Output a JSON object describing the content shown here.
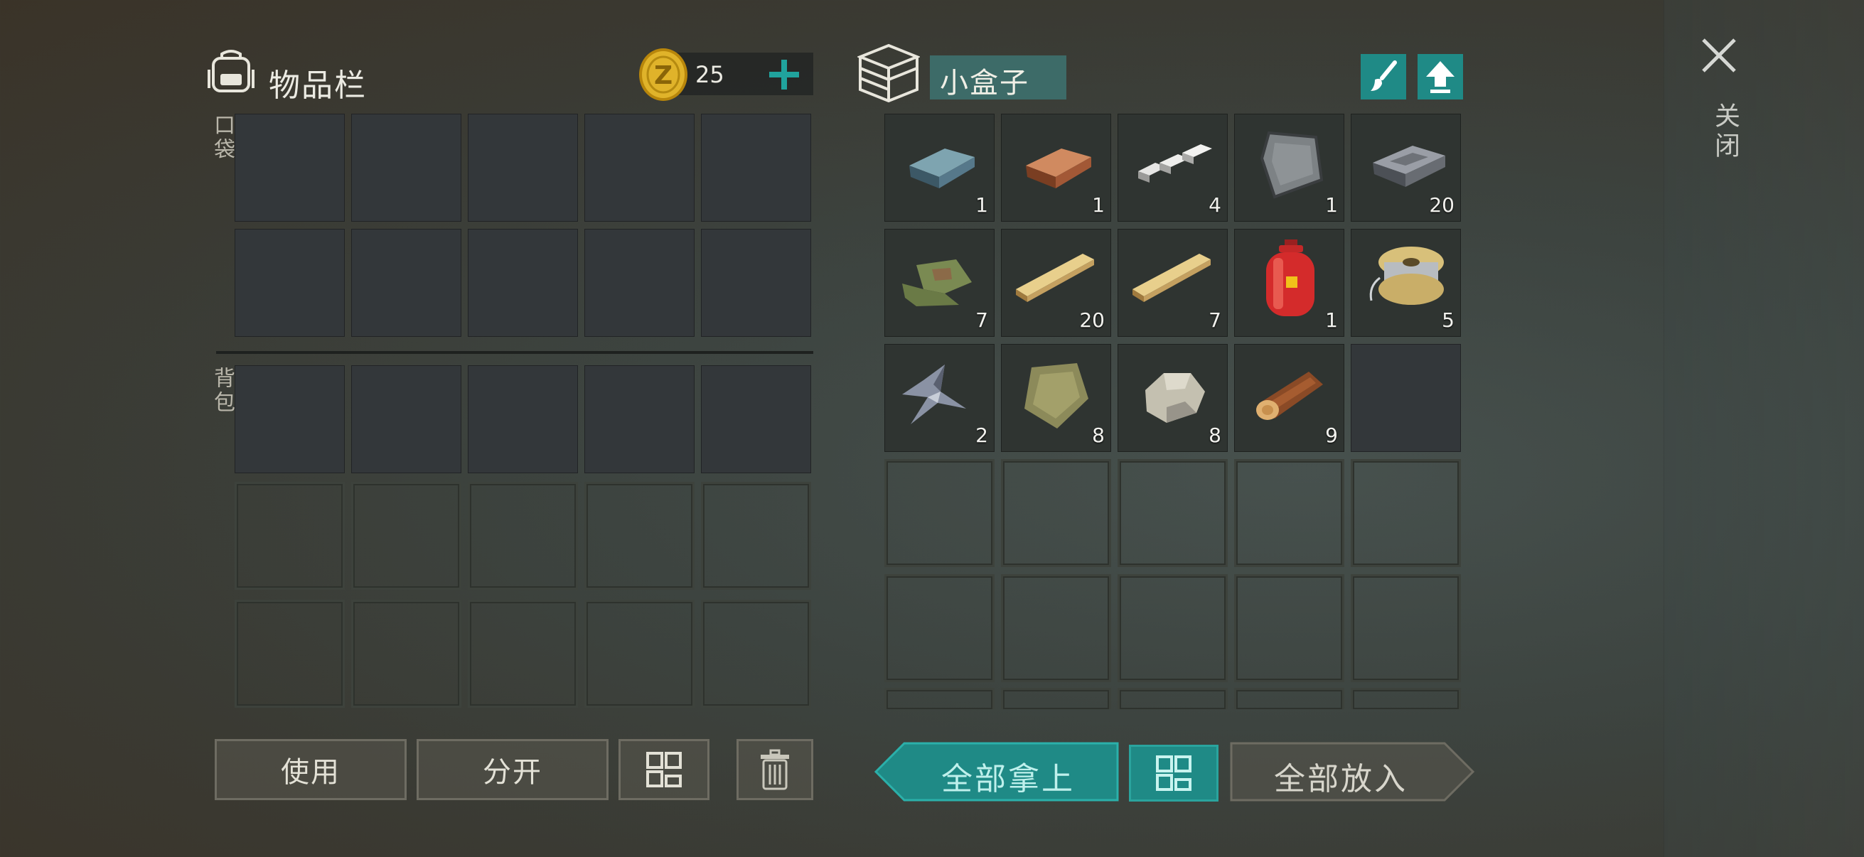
{
  "inventory": {
    "title": "物品栏",
    "coins": "25",
    "pocket_label": "口袋",
    "backpack_label": "背包"
  },
  "container": {
    "name": "小盒子",
    "items": [
      {
        "name": "steel-ingot",
        "count": "1"
      },
      {
        "name": "copper-ingot",
        "count": "1"
      },
      {
        "name": "aluminum-bars",
        "count": "4"
      },
      {
        "name": "metal-plate",
        "count": "1"
      },
      {
        "name": "iron-ingot",
        "count": "20"
      },
      {
        "name": "tarp-cloth",
        "count": "7"
      },
      {
        "name": "wood-plank",
        "count": "20"
      },
      {
        "name": "wood-plank",
        "count": "7"
      },
      {
        "name": "gas-cylinder",
        "count": "1"
      },
      {
        "name": "wire-spool",
        "count": "5"
      },
      {
        "name": "metal-scrap",
        "count": "2"
      },
      {
        "name": "burlap-cloth",
        "count": "8"
      },
      {
        "name": "stone",
        "count": "8"
      },
      {
        "name": "log",
        "count": "9"
      }
    ]
  },
  "buttons": {
    "use": "使用",
    "split": "分开",
    "take_all": "全部拿上",
    "put_all": "全部放入"
  },
  "close_label": "关闭",
  "colors": {
    "accent_teal": "#1f8a86",
    "coin_gold": "#e0b32a"
  }
}
